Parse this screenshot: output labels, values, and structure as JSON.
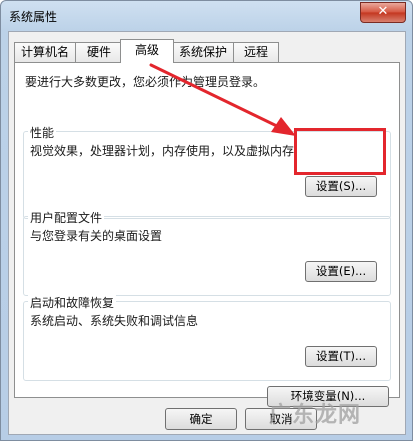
{
  "window": {
    "title": "系统属性",
    "close_glyph": "✕"
  },
  "tabs": [
    {
      "label": "计算机名",
      "active": false
    },
    {
      "label": "硬件",
      "active": false
    },
    {
      "label": "高级",
      "active": true
    },
    {
      "label": "系统保护",
      "active": false
    },
    {
      "label": "远程",
      "active": false
    }
  ],
  "panel": {
    "note": "要进行大多数更改，您必须作为管理员登录。",
    "performance": {
      "title": "性能",
      "desc": "视觉效果，处理器计划，内存使用，以及虚拟内存",
      "button": "设置(S)..."
    },
    "profile": {
      "title": "用户配置文件",
      "desc": "与您登录有关的桌面设置",
      "button": "设置(E)..."
    },
    "startup": {
      "title": "启动和故障恢复",
      "desc": "系统启动、系统失败和调试信息",
      "button": "设置(T)..."
    },
    "env_button": "环境变量(N)..."
  },
  "footer": {
    "ok": "确定",
    "cancel": "取消"
  },
  "watermark": "广东龙网",
  "annotation_color": "#e3262d"
}
